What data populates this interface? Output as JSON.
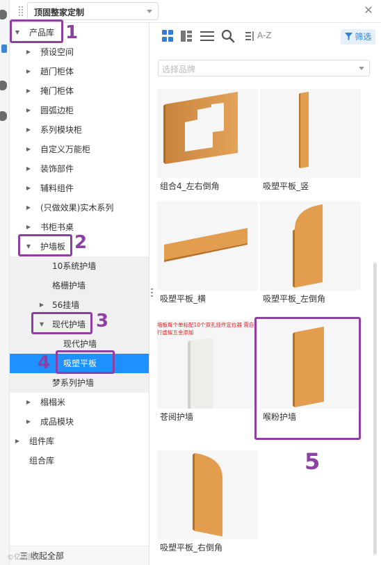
{
  "header": {
    "title": "顶固整家定制",
    "close_icon": "close-icon"
  },
  "sidebar": {
    "items": [
      {
        "label": "产品库",
        "expanded": true
      },
      {
        "label": "预设空间"
      },
      {
        "label": "趟门柜体"
      },
      {
        "label": "掩门柜体"
      },
      {
        "label": "圆弧边柜"
      },
      {
        "label": "系列模块柜"
      },
      {
        "label": "自定义万能柜"
      },
      {
        "label": "装饰部件"
      },
      {
        "label": "辅料组件"
      },
      {
        "label": "(只做效果)实木系列"
      },
      {
        "label": "书柜书桌"
      },
      {
        "label": "护墙板",
        "expanded": true
      },
      {
        "label": "10系统护墙"
      },
      {
        "label": "格栅护墙"
      },
      {
        "label": "56挂墙"
      },
      {
        "label": "现代护墙",
        "expanded": true
      },
      {
        "label": "现代护墙"
      },
      {
        "label": "吸塑平板",
        "selected": true
      },
      {
        "label": "梦系列护墙"
      },
      {
        "label": "榻榻米"
      },
      {
        "label": "成品模块"
      },
      {
        "label": "组件库"
      },
      {
        "label": "组合库"
      }
    ],
    "collapse_all": "三 收起全部"
  },
  "toolbar": {
    "sort_label": "A-Z",
    "filter_label": "筛选",
    "accent": "#2f7fd6"
  },
  "brand_select": {
    "placeholder": "选择品牌"
  },
  "products": [
    {
      "name": "组合4_左右倒角",
      "shape": "frame"
    },
    {
      "name": "吸塑平板_竖",
      "shape": "narrow-panel"
    },
    {
      "name": "吸塑平板_横",
      "shape": "horizontal-plank"
    },
    {
      "name": "吸塑平板_左倒角",
      "shape": "panel-left-round"
    },
    {
      "name": "苍阅护墙",
      "shape": "white-panel",
      "note": "墙板每个单标配10个双孔挂件定位器 需自行虚拟五金添加"
    },
    {
      "name": "喉粉护墙",
      "shape": "tilted-panel"
    },
    {
      "name": "吸塑平板_右倒角",
      "shape": "panel-right-round"
    }
  ],
  "annotations": {
    "numbers": [
      "1",
      "2",
      "3",
      "4",
      "5"
    ],
    "color": "#8e3fa3"
  },
  "watermark": "©亿图图示"
}
